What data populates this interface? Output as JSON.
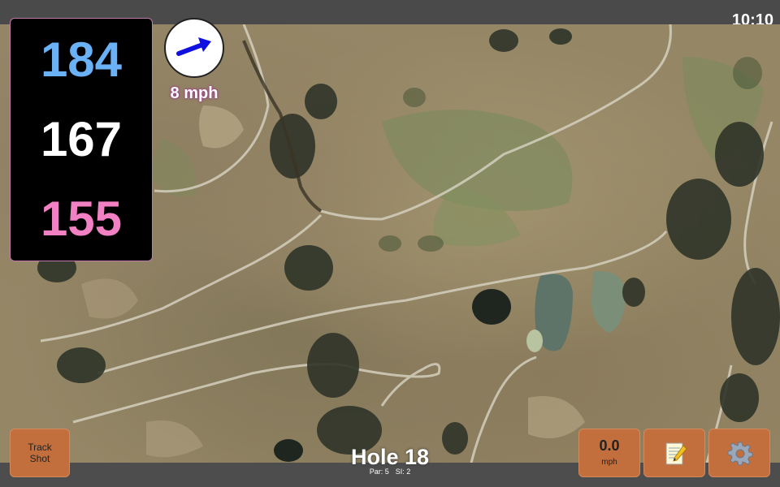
{
  "status": {
    "time": "10:10"
  },
  "distances": {
    "back": "184",
    "middle": "167",
    "front": "155"
  },
  "wind": {
    "speed_label": "8 mph",
    "icon": "wind-direction-arrow-icon"
  },
  "buttons": {
    "track_shot_label": "Track Shot",
    "speed_value": "0.0",
    "speed_unit": "mph",
    "notes_icon": "notepad-icon",
    "settings_icon": "gear-icon"
  },
  "hole": {
    "title": "Hole 18",
    "par": "Par: 5",
    "si": "SI: 2"
  },
  "colors": {
    "back": "#6ab1f5",
    "middle": "#ffffff",
    "front": "#f281c3",
    "button": "#c26f3d"
  }
}
